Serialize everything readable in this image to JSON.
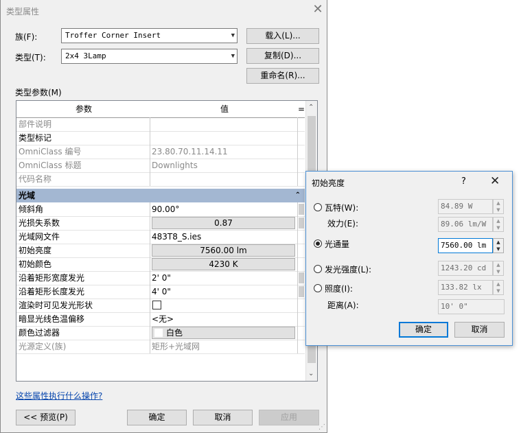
{
  "main": {
    "title": "类型属性",
    "family_label": "族(F):",
    "family_value": "Troffer Corner Insert",
    "type_label": "类型(T):",
    "type_value": "2x4 3Lamp",
    "load_button": "载入(L)...",
    "duplicate_button": "复制(D)...",
    "rename_button": "重命名(R)...",
    "params_label": "类型参数(M)",
    "help_link": "这些属性执行什么操作?",
    "preview_button": "<< 预览(P)",
    "ok_button": "确定",
    "cancel_button": "取消",
    "apply_button": "应用"
  },
  "grid": {
    "col_param": "参数",
    "col_value": "值",
    "col_eq": "=",
    "rows_top": [
      {
        "name": "部件说明",
        "value": ""
      },
      {
        "name": "类型标记",
        "value": ""
      },
      {
        "name": "OmniClass 编号",
        "value": "23.80.70.11.14.11"
      },
      {
        "name": "OmniClass 标题",
        "value": "Downlights"
      },
      {
        "name": "代码名称",
        "value": ""
      }
    ],
    "group": "光域",
    "rows_light": [
      {
        "name": "倾斜角",
        "value": "90.00°"
      },
      {
        "name": "光损失系数",
        "value": "0.87"
      },
      {
        "name": "光域网文件",
        "value": "483T8_S.ies"
      },
      {
        "name": "初始亮度",
        "value": "7560.00 lm"
      },
      {
        "name": "初始颜色",
        "value": "4230 K"
      },
      {
        "name": "沿着矩形宽度发光",
        "value": "2'  0\""
      },
      {
        "name": "沿着矩形长度发光",
        "value": "4'  0\""
      },
      {
        "name": "渲染时可见发光形状",
        "value": ""
      },
      {
        "name": "暗显光线色温偏移",
        "value": "<无>"
      },
      {
        "name": "颜色过滤器",
        "value": "白色"
      },
      {
        "name": "光源定义(族)",
        "value": "矩形+光域网"
      }
    ]
  },
  "sub": {
    "title": "初始亮度",
    "help": "?",
    "wattage_label": "瓦特(W):",
    "wattage_value": "84.89 W",
    "efficacy_label": "效力(E):",
    "efficacy_value": "89.06 lm/W",
    "flux_label": "光通量",
    "flux_value": "7560.00 lm",
    "intensity_label": "发光强度(L):",
    "intensity_value": "1243.20 cd",
    "illuminance_label": "照度(I):",
    "illuminance_value": "133.82 lx",
    "distance_label": "距离(A):",
    "distance_value": "10'  0\"",
    "ok_button": "确定",
    "cancel_button": "取消",
    "selected": "flux"
  }
}
